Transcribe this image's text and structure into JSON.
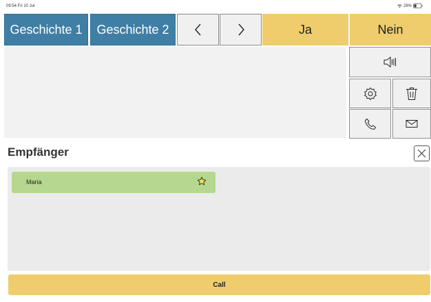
{
  "status_bar": {
    "time_date": "09:54  Fri 10 Jul",
    "battery": "28%"
  },
  "toolbar": {
    "story1": "Geschichte 1",
    "story2": "Geschichte 2",
    "prev": "<",
    "next": ">",
    "yes": "Ja",
    "no": "Nein"
  },
  "side_icons": [
    "speaker-icon",
    "gear-icon",
    "trash-icon",
    "phone-icon",
    "mail-icon"
  ],
  "recipients_section": {
    "title": "Empfänger",
    "items": [
      {
        "name": "Maria",
        "favorite": true
      }
    ]
  },
  "call_label": "Call",
  "colors": {
    "blue": "#3f7fa6",
    "yellow": "#efcd6c",
    "green": "#b5d78f"
  }
}
